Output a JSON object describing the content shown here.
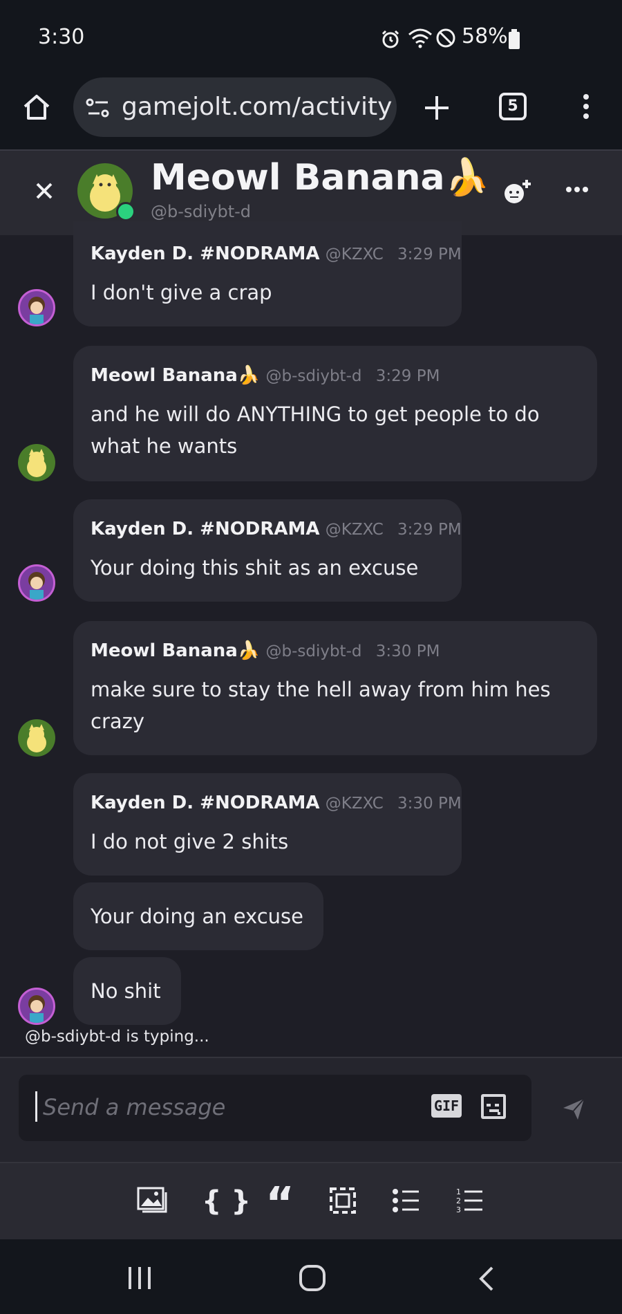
{
  "status_bar": {
    "time": "3:30",
    "battery": "58%"
  },
  "browser": {
    "url": "gamejolt.com/activity",
    "tab_count": "5"
  },
  "chat_header": {
    "name": "Meowl Banana🍌",
    "handle": "@b-sdiybt-d"
  },
  "messages": [
    {
      "author": "Kayden D. #NODRAMA",
      "handle": "@KZXC",
      "time": "3:29 PM",
      "lines": [
        "I don't give a crap"
      ]
    },
    {
      "author": "Meowl Banana🍌",
      "handle": "@b-sdiybt-d",
      "time": "3:29 PM",
      "lines": [
        "and he will do ANYTHING to get people to do",
        "what he wants"
      ]
    },
    {
      "author": "Kayden D. #NODRAMA",
      "handle": "@KZXC",
      "time": "3:29 PM",
      "lines": [
        "Your doing this shit as an excuse"
      ]
    },
    {
      "author": "Meowl Banana🍌",
      "handle": "@b-sdiybt-d",
      "time": "3:30 PM",
      "lines": [
        "make sure to stay the hell away from him hes",
        "crazy"
      ]
    },
    {
      "author": "Kayden D. #NODRAMA",
      "handle": "@KZXC",
      "time": "3:30 PM",
      "lines": [
        "I do not give 2 shits"
      ]
    },
    {
      "lines": [
        "Your doing an excuse"
      ]
    },
    {
      "lines": [
        "No shit"
      ]
    }
  ],
  "typing_indicator": "@b-sdiybt-d is typing...",
  "composer": {
    "placeholder": "Send a message",
    "gif_label": "GIF"
  },
  "toolbar": {
    "icons": [
      "image-icon",
      "code-braces-icon",
      "quote-icon",
      "spoiler-icon",
      "bullet-list-icon",
      "numbered-list-icon"
    ]
  },
  "colors": {
    "online": "#2bd17e",
    "accent_banana": "#f5d33b",
    "bubble": "#2b2b34",
    "background": "#1e1e26"
  }
}
